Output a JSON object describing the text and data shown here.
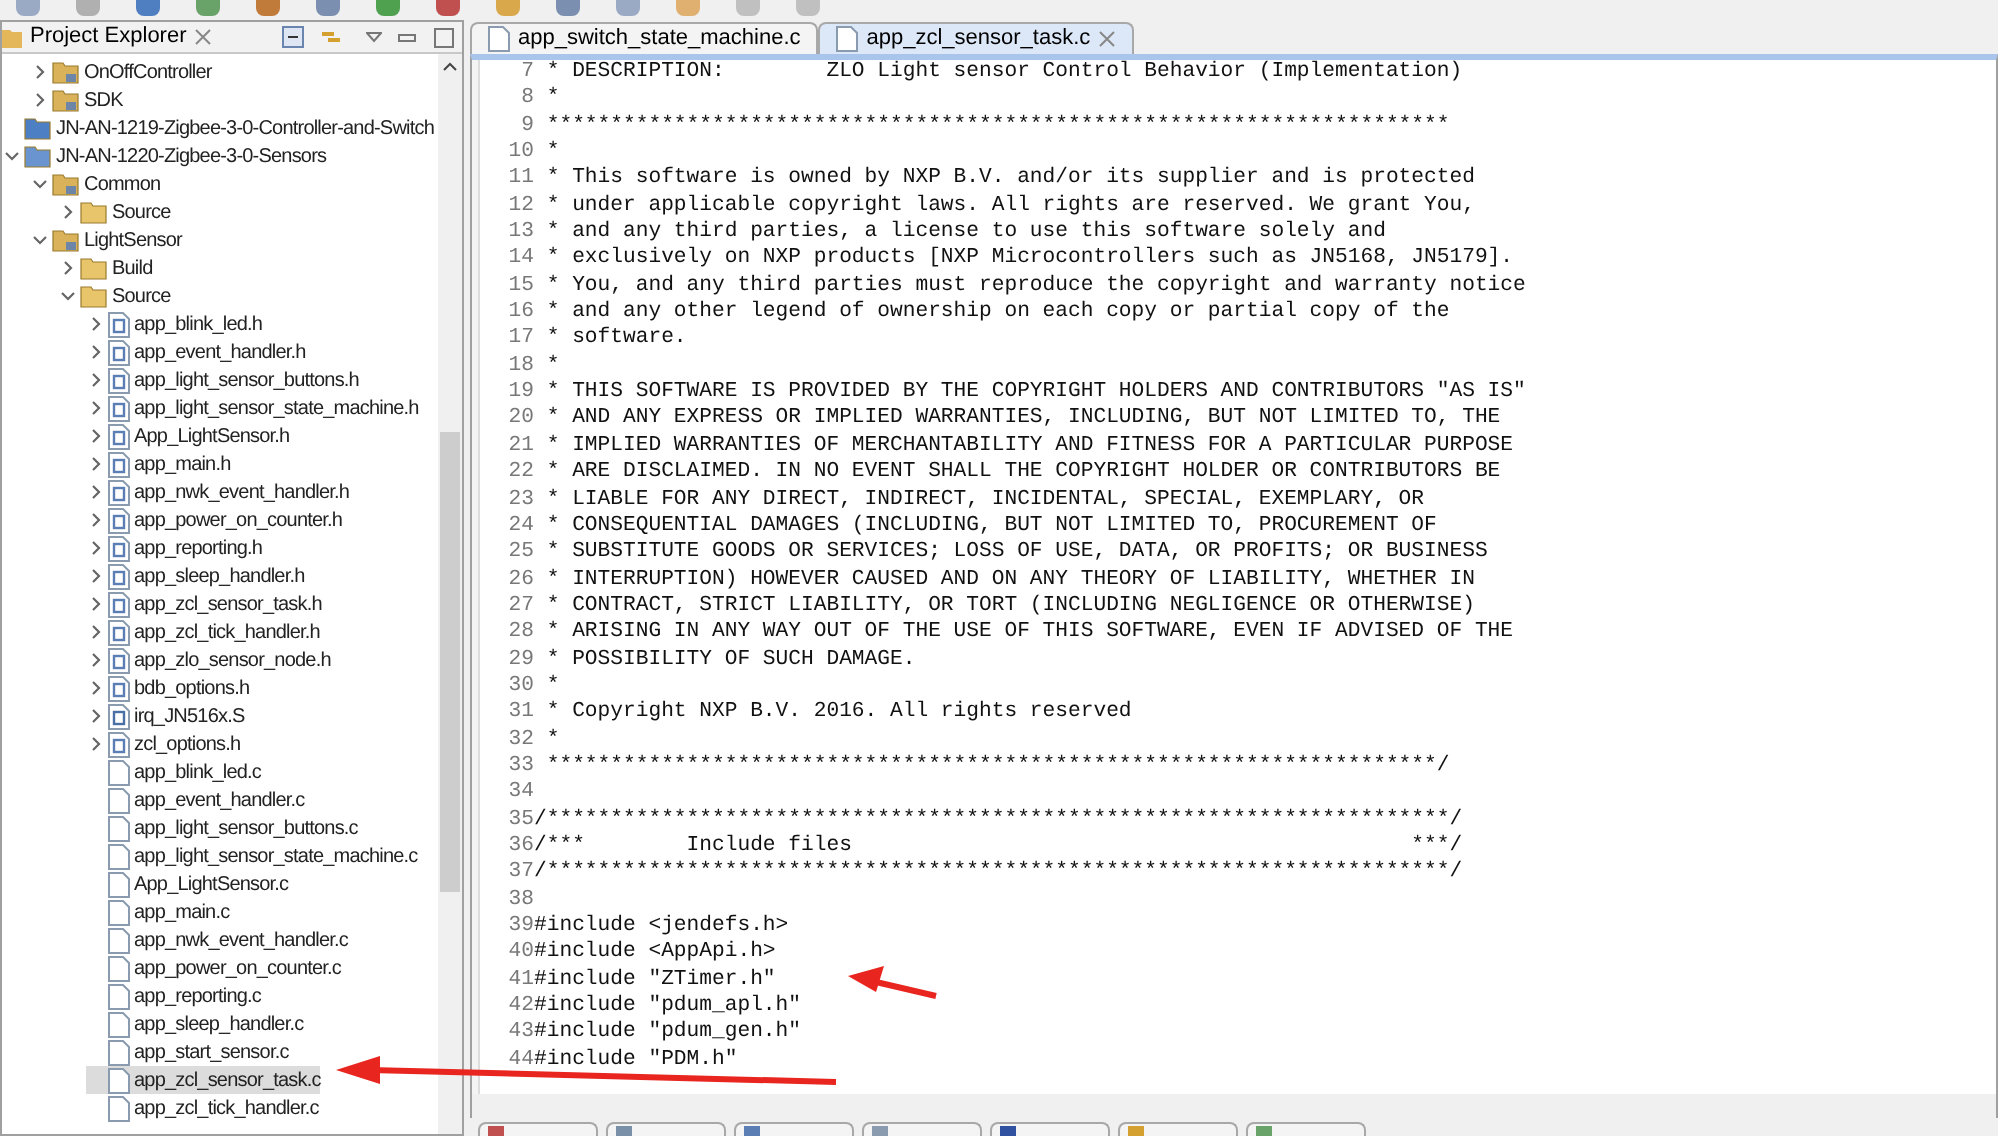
{
  "explorer": {
    "title": "Project Explorer",
    "tree": {
      "continued_items": [
        {
          "label": "OnOffController",
          "kind": "folder",
          "expanded": false,
          "selected": false
        },
        {
          "label": "SDK",
          "kind": "folder",
          "expanded": false,
          "selected": false
        }
      ],
      "items": [
        {
          "label": "JN-AN-1219-Zigbee-3-0-Controller-and-Switch",
          "kind": "closed-project",
          "selected": false
        },
        {
          "label": "JN-AN-1220-Zigbee-3-0-Sensors",
          "kind": "project",
          "expanded": true,
          "selected": false,
          "children": [
            {
              "label": "Common",
              "kind": "folder",
              "expanded": true,
              "selected": false,
              "children": [
                {
                  "label": "Source",
                  "kind": "source-folder",
                  "expanded": false,
                  "selected": false
                }
              ]
            },
            {
              "label": "LightSensor",
              "kind": "folder",
              "expanded": true,
              "selected": false,
              "children": [
                {
                  "label": "Build",
                  "kind": "source-folder",
                  "expanded": false,
                  "selected": false
                },
                {
                  "label": "Source",
                  "kind": "source-folder",
                  "expanded": true,
                  "selected": false,
                  "children": [
                    {
                      "label": "app_blink_led.h",
                      "kind": "header",
                      "expanded": false,
                      "selected": false
                    },
                    {
                      "label": "app_event_handler.h",
                      "kind": "header",
                      "expanded": false,
                      "selected": false
                    },
                    {
                      "label": "app_light_sensor_buttons.h",
                      "kind": "header",
                      "expanded": false,
                      "selected": false
                    },
                    {
                      "label": "app_light_sensor_state_machine.h",
                      "kind": "header",
                      "expanded": false,
                      "selected": false
                    },
                    {
                      "label": "App_LightSensor.h",
                      "kind": "header",
                      "expanded": false,
                      "selected": false
                    },
                    {
                      "label": "app_main.h",
                      "kind": "header",
                      "expanded": false,
                      "selected": false
                    },
                    {
                      "label": "app_nwk_event_handler.h",
                      "kind": "header",
                      "expanded": false,
                      "selected": false
                    },
                    {
                      "label": "app_power_on_counter.h",
                      "kind": "header",
                      "expanded": false,
                      "selected": false
                    },
                    {
                      "label": "app_reporting.h",
                      "kind": "header",
                      "expanded": false,
                      "selected": false
                    },
                    {
                      "label": "app_sleep_handler.h",
                      "kind": "header",
                      "expanded": false,
                      "selected": false
                    },
                    {
                      "label": "app_zcl_sensor_task.h",
                      "kind": "header",
                      "expanded": false,
                      "selected": false
                    },
                    {
                      "label": "app_zcl_tick_handler.h",
                      "kind": "header",
                      "expanded": false,
                      "selected": false
                    },
                    {
                      "label": "app_zlo_sensor_node.h",
                      "kind": "header",
                      "expanded": false,
                      "selected": false
                    },
                    {
                      "label": "bdb_options.h",
                      "kind": "header",
                      "expanded": false,
                      "selected": false
                    },
                    {
                      "label": "irq_JN516x.S",
                      "kind": "assembly",
                      "expanded": false,
                      "selected": false
                    },
                    {
                      "label": "zcl_options.h",
                      "kind": "header",
                      "expanded": false,
                      "selected": false
                    },
                    {
                      "label": "app_blink_led.c",
                      "kind": "source",
                      "selected": false
                    },
                    {
                      "label": "app_event_handler.c",
                      "kind": "source",
                      "selected": false
                    },
                    {
                      "label": "app_light_sensor_buttons.c",
                      "kind": "source",
                      "selected": false
                    },
                    {
                      "label": "app_light_sensor_state_machine.c",
                      "kind": "source",
                      "selected": false
                    },
                    {
                      "label": "App_LightSensor.c",
                      "kind": "source",
                      "selected": false
                    },
                    {
                      "label": "app_main.c",
                      "kind": "source",
                      "selected": false
                    },
                    {
                      "label": "app_nwk_event_handler.c",
                      "kind": "source",
                      "selected": false
                    },
                    {
                      "label": "app_power_on_counter.c",
                      "kind": "source",
                      "selected": false
                    },
                    {
                      "label": "app_reporting.c",
                      "kind": "source",
                      "selected": false
                    },
                    {
                      "label": "app_sleep_handler.c",
                      "kind": "source",
                      "selected": false
                    },
                    {
                      "label": "app_start_sensor.c",
                      "kind": "source",
                      "selected": false
                    },
                    {
                      "label": "app_zcl_sensor_task.c",
                      "kind": "source",
                      "selected": true
                    },
                    {
                      "label": "app_zcl_tick_handler.c",
                      "kind": "source",
                      "selected": false
                    }
                  ]
                }
              ]
            }
          ]
        }
      ]
    }
  },
  "editor": {
    "tabs": [
      {
        "label": "app_switch_state_machine.c",
        "selected": false
      },
      {
        "label": "app_zcl_sensor_task.c",
        "selected": true
      }
    ],
    "lines": [
      {
        "number": "7",
        "text": " * DESCRIPTION:        ZLO Light sensor Control Behavior (Implementation)"
      },
      {
        "number": "8",
        "text": " *"
      },
      {
        "number": "9",
        "text": " ***********************************************************************"
      },
      {
        "number": "10",
        "text": " *"
      },
      {
        "number": "11",
        "text": " * This software is owned by NXP B.V. and/or its supplier and is protected"
      },
      {
        "number": "12",
        "text": " * under applicable copyright laws. All rights are reserved. We grant You,"
      },
      {
        "number": "13",
        "text": " * and any third parties, a license to use this software solely and"
      },
      {
        "number": "14",
        "text": " * exclusively on NXP products [NXP Microcontrollers such as JN5168, JN5179]."
      },
      {
        "number": "15",
        "text": " * You, and any third parties must reproduce the copyright and warranty notice"
      },
      {
        "number": "16",
        "text": " * and any other legend of ownership on each copy or partial copy of the"
      },
      {
        "number": "17",
        "text": " * software."
      },
      {
        "number": "18",
        "text": " *"
      },
      {
        "number": "19",
        "text": " * THIS SOFTWARE IS PROVIDED BY THE COPYRIGHT HOLDERS AND CONTRIBUTORS \"AS IS\""
      },
      {
        "number": "20",
        "text": " * AND ANY EXPRESS OR IMPLIED WARRANTIES, INCLUDING, BUT NOT LIMITED TO, THE"
      },
      {
        "number": "21",
        "text": " * IMPLIED WARRANTIES OF MERCHANTABILITY AND FITNESS FOR A PARTICULAR PURPOSE"
      },
      {
        "number": "22",
        "text": " * ARE DISCLAIMED. IN NO EVENT SHALL THE COPYRIGHT HOLDER OR CONTRIBUTORS BE"
      },
      {
        "number": "23",
        "text": " * LIABLE FOR ANY DIRECT, INDIRECT, INCIDENTAL, SPECIAL, EXEMPLARY, OR"
      },
      {
        "number": "24",
        "text": " * CONSEQUENTIAL DAMAGES (INCLUDING, BUT NOT LIMITED TO, PROCUREMENT OF"
      },
      {
        "number": "25",
        "text": " * SUBSTITUTE GOODS OR SERVICES; LOSS OF USE, DATA, OR PROFITS; OR BUSINESS"
      },
      {
        "number": "26",
        "text": " * INTERRUPTION) HOWEVER CAUSED AND ON ANY THEORY OF LIABILITY, WHETHER IN"
      },
      {
        "number": "27",
        "text": " * CONTRACT, STRICT LIABILITY, OR TORT (INCLUDING NEGLIGENCE OR OTHERWISE)"
      },
      {
        "number": "28",
        "text": " * ARISING IN ANY WAY OUT OF THE USE OF THIS SOFTWARE, EVEN IF ADVISED OF THE"
      },
      {
        "number": "29",
        "text": " * POSSIBILITY OF SUCH DAMAGE."
      },
      {
        "number": "30",
        "text": " *"
      },
      {
        "number": "31",
        "text": " * Copyright NXP B.V. 2016. All rights reserved"
      },
      {
        "number": "32",
        "text": " *"
      },
      {
        "number": "33",
        "text": " **********************************************************************/"
      },
      {
        "number": "34"
      },
      {
        "number": "35",
        "text": "/***********************************************************************/"
      },
      {
        "number": "36",
        "text": "/***        Include files                                            ***/"
      },
      {
        "number": "37",
        "text": "/***********************************************************************/"
      },
      {
        "number": "38"
      },
      {
        "number": "39",
        "text": "#include <jendefs.h>"
      },
      {
        "number": "40",
        "text": "#include <AppApi.h>"
      },
      {
        "number": "41",
        "text": "#include \"ZTimer.h\""
      },
      {
        "number": "42",
        "text": "#include \"pdum_apl.h\""
      },
      {
        "number": "43",
        "text": "#include \"pdum_gen.h\""
      },
      {
        "number": "44",
        "text": "#include \"PDM.h\""
      }
    ]
  }
}
